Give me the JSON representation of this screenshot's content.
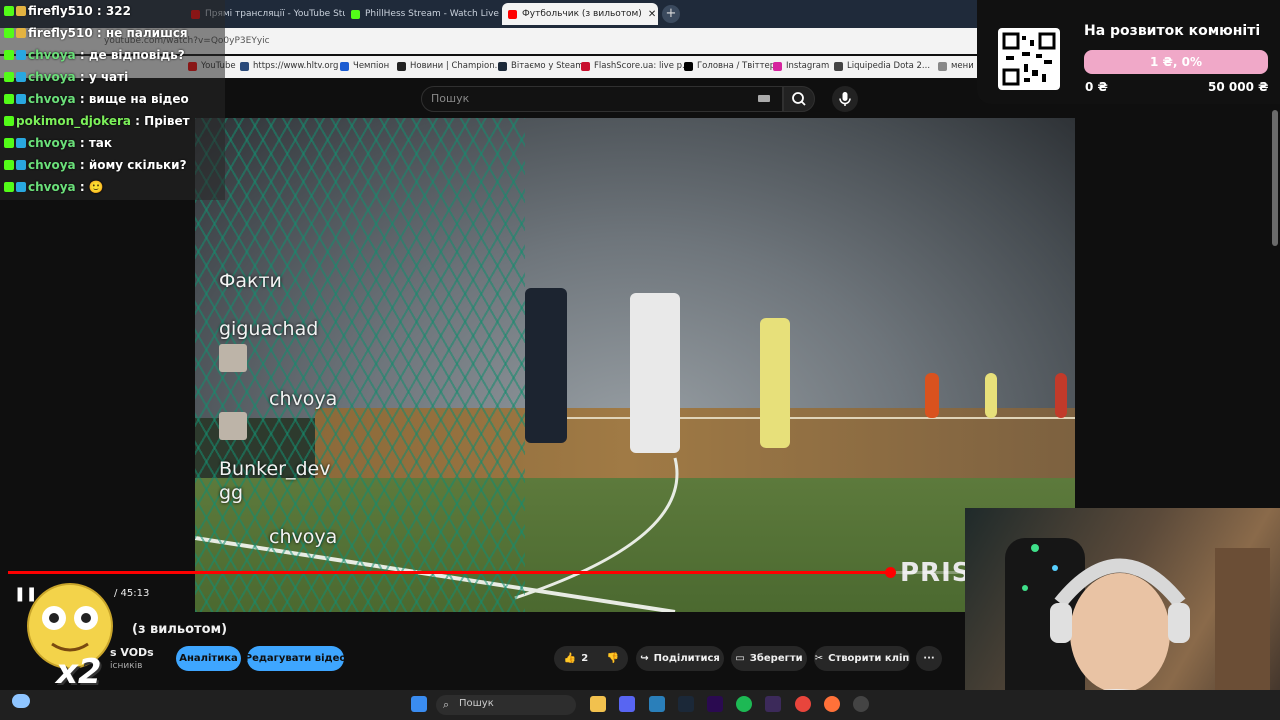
{
  "browser": {
    "tabs": [
      {
        "label": "Прямі трансляції - YouTube Studio",
        "active": false,
        "color": "#ff0000"
      },
      {
        "label": "PhillHess Stream - Watch Live o",
        "active": false,
        "color": "#53fc18"
      },
      {
        "label": "Футбольчик (з вильотом)",
        "active": true,
        "color": "#ff0000"
      }
    ],
    "url": "youtube.com/watch?v=Qo0yP3EYyic",
    "bookmarks": [
      {
        "label": "YouTube",
        "color": "#ff0000"
      },
      {
        "label": "https://www.hltv.org",
        "color": "#2a4a7a"
      },
      {
        "label": "Чемпіон",
        "color": "#1a5bd1"
      },
      {
        "label": "Новини | Champion...",
        "color": "#222"
      },
      {
        "label": "Вітаємо у Steam",
        "color": "#1b2838"
      },
      {
        "label": "FlashScore.ua: live p...",
        "color": "#c8102e"
      },
      {
        "label": "Головна / Твіттер",
        "color": "#000"
      },
      {
        "label": "Instagram",
        "color": "#d6249f"
      },
      {
        "label": "Liquipedia Dota 2...",
        "color": "#444"
      },
      {
        "label": "мени",
        "color": "#888"
      }
    ]
  },
  "youtube": {
    "search_placeholder": "Пошук",
    "video": {
      "title_fragment": "(з вильотом)",
      "time": "/ 45:13",
      "progress_fraction": 0.882,
      "watermark": "PRIS",
      "overlay_messages": [
        {
          "user": "Факти",
          "top": 0
        },
        {
          "user": "giguachad"
        },
        {
          "user": "chvoya"
        },
        {
          "user": "Bunker_dev",
          "msg": "gg"
        },
        {
          "user": "chvoya"
        }
      ]
    },
    "channel": "s VODs",
    "subscribers": "ісників",
    "buttons": {
      "analytics": "Аналітика",
      "edit": "Редагувати відео",
      "likes": "2",
      "share": "Поділитися",
      "save": "Зберегти",
      "clip": "Створити кліп",
      "more": "···"
    }
  },
  "chat": [
    {
      "user": "firefly510",
      "msg": ": 322",
      "color": "#ffffff"
    },
    {
      "user": "firefly510",
      "msg": ": не палишся",
      "color": "#ffffff"
    },
    {
      "user": "chvoya",
      "msg": ": де відповідь?",
      "color": "#6be07a"
    },
    {
      "user": "chvoya",
      "msg": ": у чаті",
      "color": "#6be07a"
    },
    {
      "user": "chvoya",
      "msg": ": вище на відео",
      "color": "#6be07a"
    },
    {
      "user": "pokimon_djokera",
      "msg": ": Прівет",
      "color": "#7cf05a"
    },
    {
      "user": "chvoya",
      "msg": ": так",
      "color": "#6be07a"
    },
    {
      "user": "chvoya",
      "msg": ": йому скільки?",
      "color": "#6be07a"
    },
    {
      "user": "chvoya",
      "msg": ": 🙂",
      "color": "#6be07a"
    }
  ],
  "donation": {
    "title": "На розвиток комюніті",
    "percent": "1 ₴, 0%",
    "min": "0 ₴",
    "max": "50 000 ₴",
    "fill_fraction": 0.0
  },
  "emote_text": "x2",
  "taskbar": {
    "search": "Пошук",
    "icons": [
      "windows-icon",
      "search-icon",
      "files-icon",
      "discord-icon",
      "steam-icon",
      "steam-client-icon",
      "premiere-icon",
      "spotify-icon",
      "obs-icon",
      "chrome-icon",
      "firefox-icon",
      "mic-icon"
    ]
  }
}
